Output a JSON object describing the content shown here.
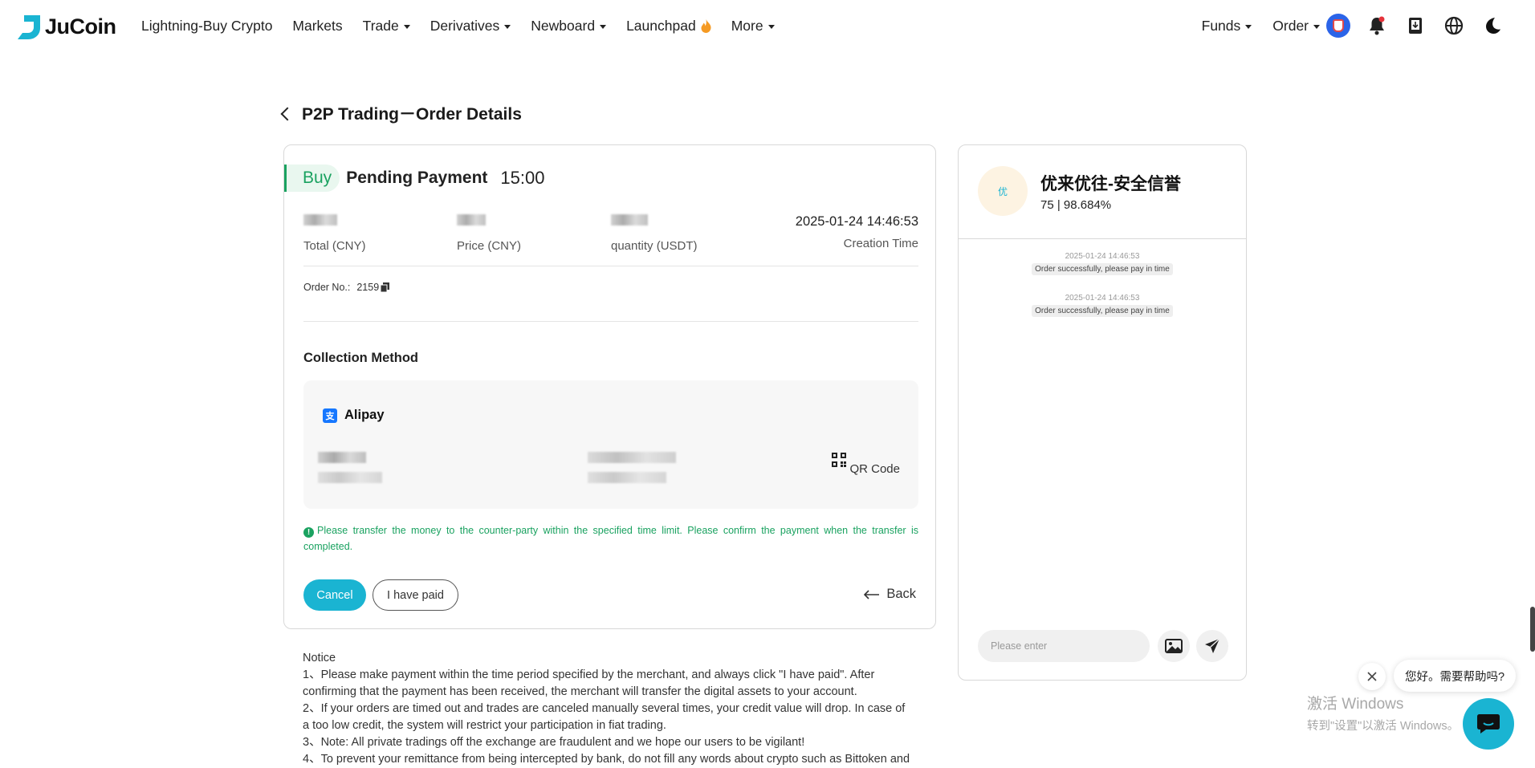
{
  "nav": {
    "logo_text": "JuCoin",
    "items": [
      {
        "label": "Lightning-Buy Crypto",
        "caret": false
      },
      {
        "label": "Markets",
        "caret": false
      },
      {
        "label": "Trade",
        "caret": true
      },
      {
        "label": "Derivatives",
        "caret": true
      },
      {
        "label": "Newboard",
        "caret": true
      },
      {
        "label": "Launchpad",
        "caret": false
      },
      {
        "label": "More",
        "caret": true
      }
    ],
    "right_items": [
      {
        "label": "Funds"
      },
      {
        "label": "Order"
      }
    ],
    "icons": [
      "avatar",
      "bell-icon",
      "download-icon",
      "globe-icon",
      "moon-icon"
    ]
  },
  "page": {
    "title": "P2P Trading－Order Details"
  },
  "order": {
    "side": "Buy",
    "status": "Pending Payment",
    "countdown": "15:00",
    "stats": [
      {
        "label": "Total (CNY)"
      },
      {
        "label": "Price (CNY)"
      },
      {
        "label": "quantity (USDT)"
      }
    ],
    "creation_time": "2025-01-24 14:46:53",
    "creation_label": "Creation Time",
    "order_no_label": "Order No.:",
    "order_no": "2159",
    "collection_method_title": "Collection Method",
    "payment_method": "Alipay",
    "qr_label": "QR Code",
    "warning": "Please transfer the money to the counter-party within the specified time limit. Please confirm the payment when the transfer is completed.",
    "cancel_label": "Cancel",
    "paid_label": "I have paid",
    "back_label": "Back"
  },
  "notice": {
    "title": "Notice",
    "lines": [
      "1、Please make payment within the time period specified by the merchant, and always click \"I have paid\". After confirming that the payment has been received, the merchant will transfer the digital assets to your account.",
      "2、If your orders are timed out and trades are canceled manually several times, your credit value will drop. In case of a too low credit, the system will restrict your participation in fiat trading.",
      "3、Note: All private tradings off the exchange are fraudulent and we hope our users to be vigilant!",
      "4、To prevent your remittance from being intercepted by bank, do not fill any words about crypto such as Bittoken and"
    ]
  },
  "chat": {
    "merchant_avatar": "优",
    "merchant_name": "优来优往-安全信誉",
    "merchant_stats": "75 | 98.684%",
    "messages": [
      {
        "time": "2025-01-24 14:46:53",
        "text": "Order successfully, please pay in time"
      },
      {
        "time": "2025-01-24 14:46:53",
        "text": "Order successfully, please pay in time"
      }
    ],
    "input_placeholder": "Please enter"
  },
  "support": {
    "bubble_text": "您好。需要帮助吗?"
  },
  "watermark": {
    "line1": "激活 Windows",
    "line2": "转到\"设置\"以激活 Windows。"
  },
  "colors": {
    "accent": "#1ab4d2",
    "success": "#1aa260",
    "border": "#d8d8d8"
  }
}
